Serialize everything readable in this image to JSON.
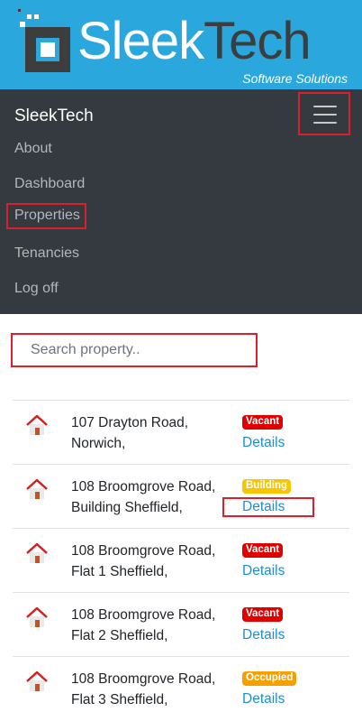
{
  "brand": {
    "logo_word_light": "Sleek",
    "logo_word_dark": "Tech",
    "tagline": "Software Solutions",
    "banner_color": "#2aa7dc"
  },
  "navbar": {
    "brand": "SleekTech",
    "toggler_icon": "hamburger-icon",
    "items": [
      {
        "label": "About"
      },
      {
        "label": "Dashboard"
      },
      {
        "label": "Properties"
      },
      {
        "label": "Tenancies"
      },
      {
        "label": "Log off"
      }
    ]
  },
  "search": {
    "placeholder": "Search property.."
  },
  "properties": [
    {
      "line1": "107 Drayton Road,",
      "line2": "Norwich,",
      "status": "Vacant",
      "action": "Details",
      "icon": "house-icon"
    },
    {
      "line1": "108 Broomgrove Road,",
      "line2": "Building Sheffield,",
      "status": "Building",
      "action": "Details",
      "icon": "house-icon"
    },
    {
      "line1": "108 Broomgrove Road,",
      "line2": "Flat 1 Sheffield,",
      "status": "Vacant",
      "action": "Details",
      "icon": "house-icon"
    },
    {
      "line1": "108 Broomgrove Road,",
      "line2": "Flat 2 Sheffield,",
      "status": "Vacant",
      "action": "Details",
      "icon": "house-icon"
    },
    {
      "line1": "108 Broomgrove Road,",
      "line2": "Flat 3 Sheffield,",
      "status": "Occupied",
      "action": "Details",
      "icon": "house-icon"
    }
  ],
  "colors": {
    "navbar_bg": "#343a40",
    "vacant": "#e00000",
    "building": "#f7c600",
    "occupied": "#f6a000",
    "link": "#1a8fd0",
    "highlight": "#dc1f2b"
  }
}
